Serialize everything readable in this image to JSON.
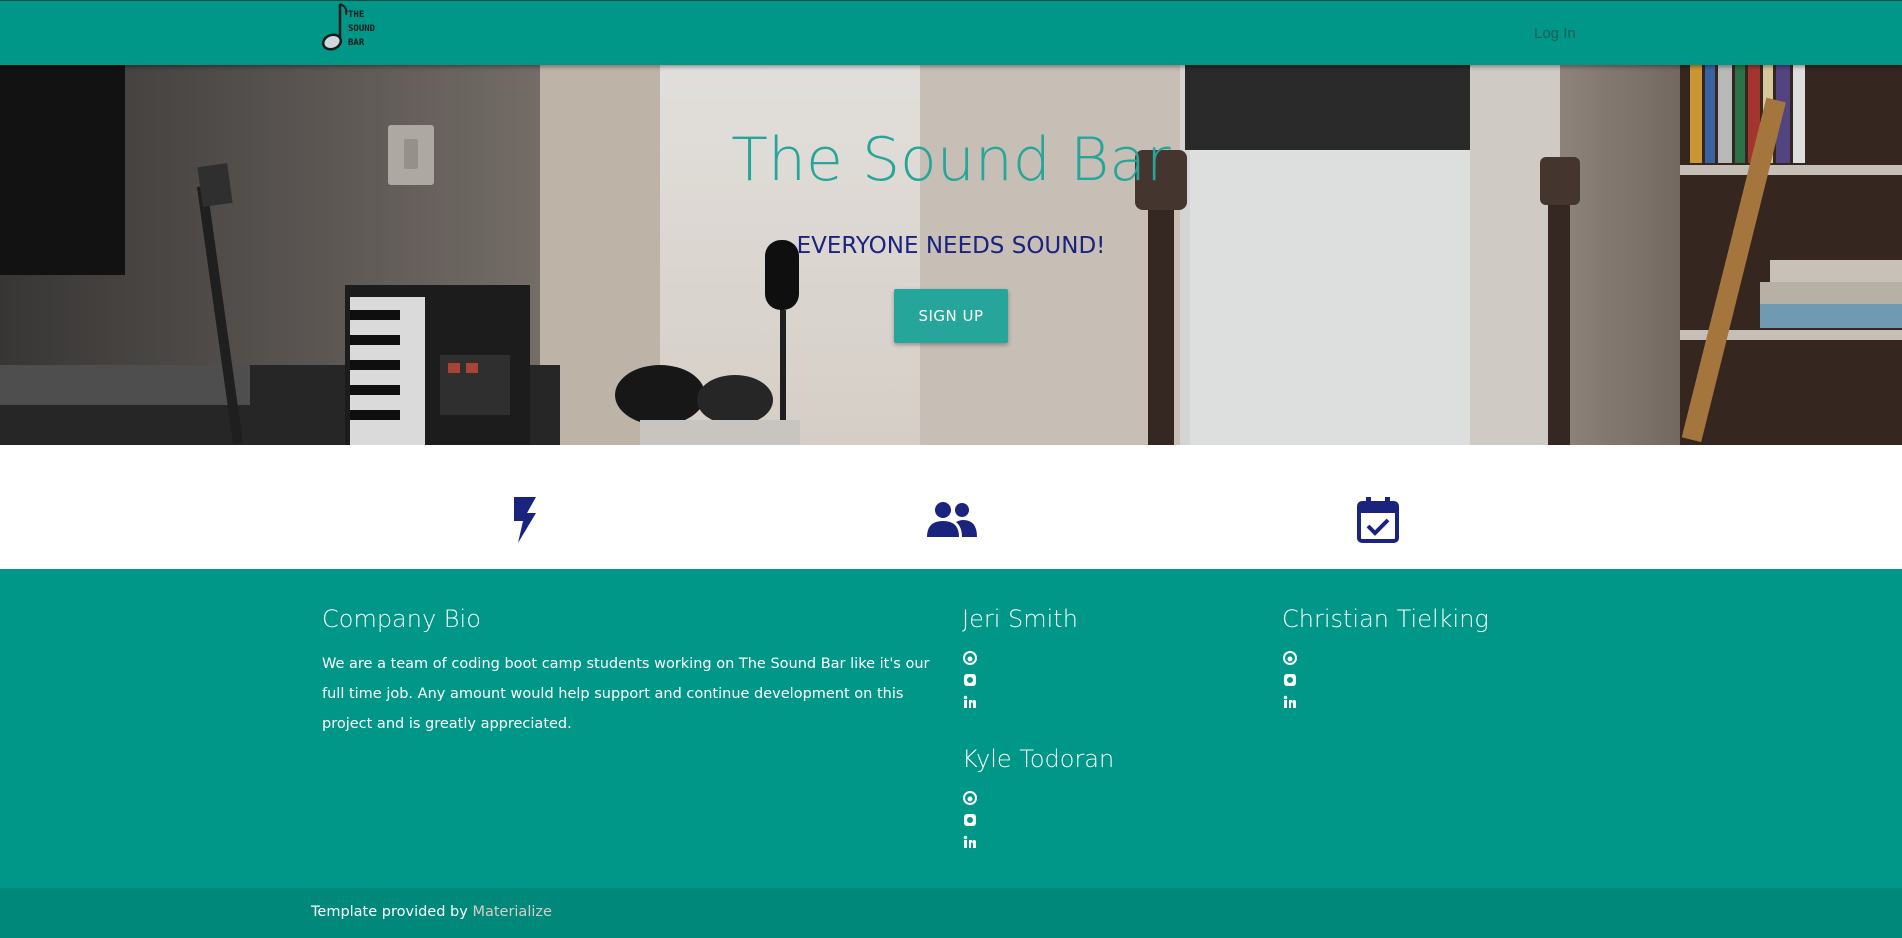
{
  "nav": {
    "logo_lines": [
      "THE",
      "SOUND",
      "BAR"
    ],
    "login_label": "Log In"
  },
  "hero": {
    "title": "The Sound Bar",
    "subtitle": "EVERYONE NEEDS SOUND!",
    "signup_label": "SIGN UP"
  },
  "features": {
    "icons": [
      "flash-icon",
      "group-icon",
      "calendar-check-icon"
    ]
  },
  "footer": {
    "bio_title": "Company Bio",
    "bio_text": "We are a team of coding boot camp students working on The Sound Bar like it's our full time job. Any amount would help support and continue development on this project and is greatly appreciated.",
    "members": [
      {
        "name": "Jeri Smith",
        "icons": [
          "github-icon",
          "instagram-icon",
          "linkedin-icon"
        ]
      },
      {
        "name": "Christian Tielking",
        "icons": [
          "github-icon",
          "instagram-icon",
          "linkedin-icon"
        ]
      },
      {
        "name": "Kyle Todoran",
        "icons": [
          "github-icon",
          "instagram-icon",
          "linkedin-icon"
        ]
      }
    ]
  },
  "copyright": {
    "prefix": "Template provided by ",
    "link_label": "Materialize"
  },
  "colors": {
    "teal": "#009688",
    "teal_dark": "#00897b",
    "accent": "#26a69a",
    "indigo": "#1a237e"
  }
}
